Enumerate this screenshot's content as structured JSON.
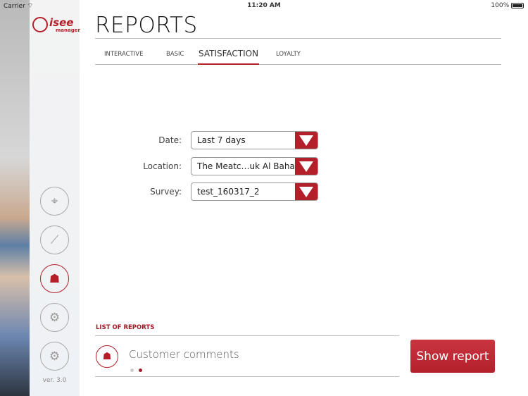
{
  "status_bar": {
    "carrier": "Carrier",
    "time": "11:20 AM",
    "battery": "100%"
  },
  "logo": {
    "name": "isee",
    "sub": "manager"
  },
  "sidebar": {
    "items": [
      {
        "name": "location"
      },
      {
        "name": "analytics"
      },
      {
        "name": "reports",
        "active": true
      },
      {
        "name": "user-settings"
      },
      {
        "name": "settings"
      }
    ],
    "version": "ver. 3.0"
  },
  "header": {
    "title": "REPORTS"
  },
  "tabs": [
    {
      "label": "INTERACTIVE"
    },
    {
      "label": "BASIC"
    },
    {
      "label": "SATISFACTION",
      "active": true
    },
    {
      "label": "LOYALTY"
    }
  ],
  "filters": {
    "date": {
      "label": "Date:",
      "value": "Last 7 days"
    },
    "location": {
      "label": "Location:",
      "value": "The Meatc…uk Al Bahar"
    },
    "survey": {
      "label": "Survey:",
      "value": "test_160317_2"
    }
  },
  "reports": {
    "heading": "LIST OF REPORTS",
    "items": [
      {
        "name": "Customer comments"
      }
    ],
    "page": 2,
    "pages": 2,
    "show_button": "Show report"
  },
  "colors": {
    "accent": "#b3202a"
  }
}
